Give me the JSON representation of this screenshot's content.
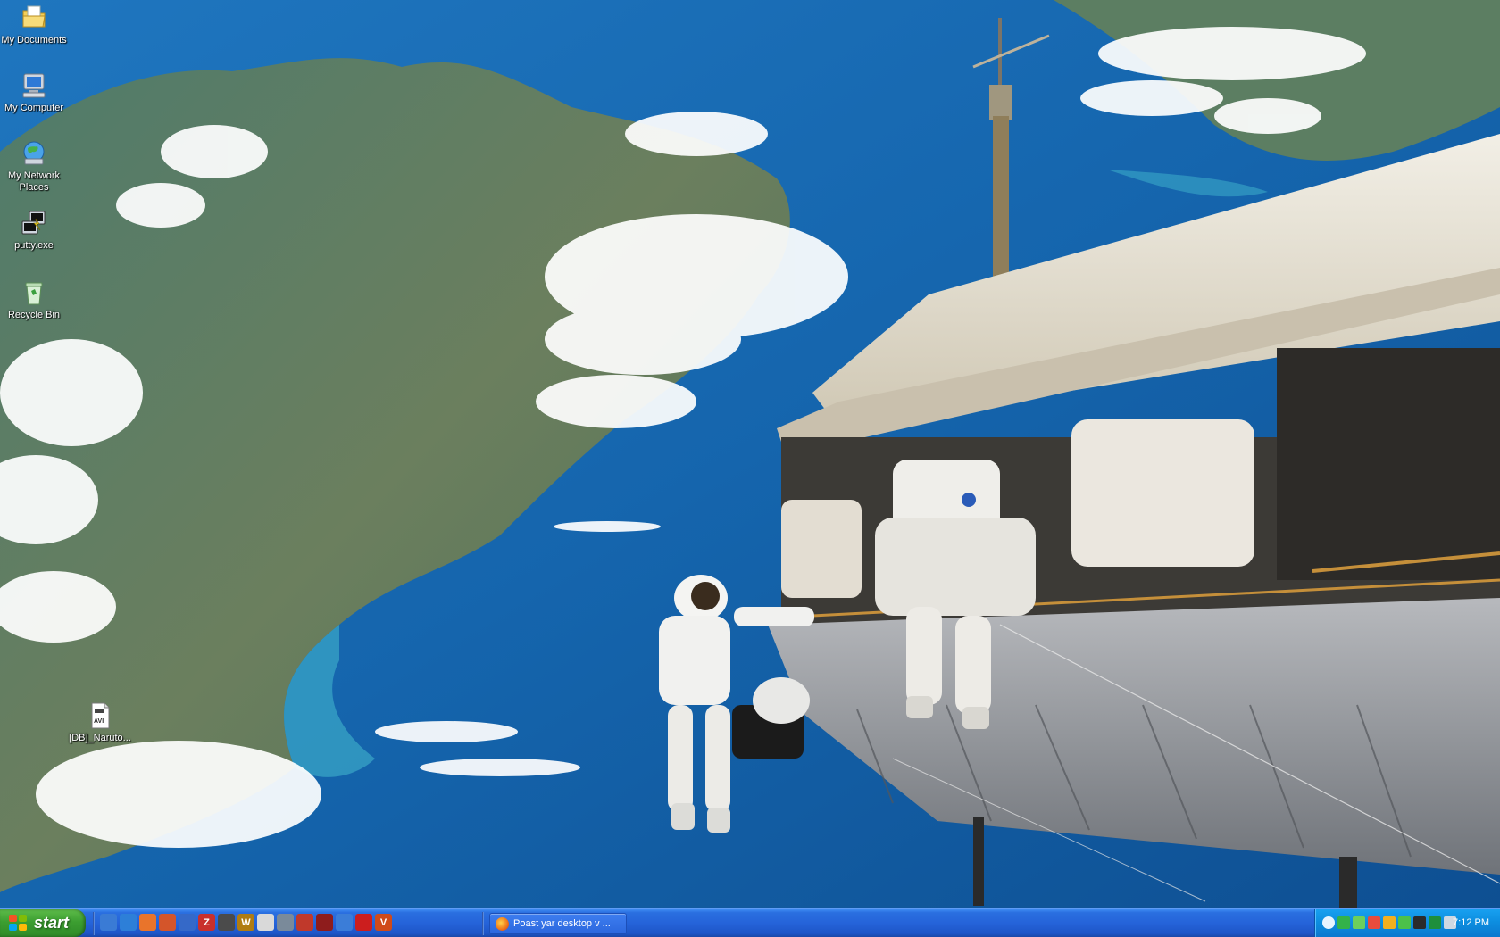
{
  "desktop": {
    "icons": [
      {
        "label": "My Documents",
        "icon": "folder-documents-icon"
      },
      {
        "label": "My Computer",
        "icon": "computer-icon"
      },
      {
        "label": "My Network Places",
        "icon": "network-places-icon"
      },
      {
        "label": "putty.exe",
        "icon": "putty-icon"
      },
      {
        "label": "Recycle Bin",
        "icon": "recycle-bin-icon"
      },
      {
        "label": "[DB]_Naruto...",
        "icon": "avi-video-file-icon",
        "badge": "AVI"
      }
    ]
  },
  "taskbar": {
    "start_label": "start",
    "quick_launch": [
      {
        "icon": "show-desktop-icon",
        "color": "#3a7bd5"
      },
      {
        "icon": "internet-explorer-icon",
        "color": "#2d7fd8"
      },
      {
        "icon": "firefox-icon",
        "color": "#e9742b"
      },
      {
        "icon": "firefox-alt-icon",
        "color": "#d4552a"
      },
      {
        "icon": "media-player-icon",
        "color": "#3569c8"
      },
      {
        "icon": "z-app-icon",
        "color": "#c9302c",
        "glyph": "Z"
      },
      {
        "icon": "calculator-icon",
        "color": "#4b4b4b"
      },
      {
        "icon": "winamp-icon",
        "color": "#b07c12",
        "glyph": "W"
      },
      {
        "icon": "notepad-icon",
        "color": "#d9d9d9"
      },
      {
        "icon": "camera-icon",
        "color": "#7a8a9a"
      },
      {
        "icon": "arrow-app-icon",
        "color": "#c0392b"
      },
      {
        "icon": "game-app-icon",
        "color": "#8e1c1c"
      },
      {
        "icon": "network-tool-icon",
        "color": "#3b7dd8"
      },
      {
        "icon": "opera-icon",
        "color": "#cc1e1e"
      },
      {
        "icon": "vlc-app-icon",
        "color": "#d04a1a",
        "glyph": "V"
      }
    ],
    "tasks": [
      {
        "label": "Poast yar desktop v ...",
        "icon": "firefox-icon"
      }
    ]
  },
  "tray": {
    "icons": [
      {
        "icon": "tray-collapse-icon",
        "color": "#e8f4ff"
      },
      {
        "icon": "messenger-icon",
        "color": "#33b24a"
      },
      {
        "icon": "network-activity-icon",
        "color": "#6ccf5c"
      },
      {
        "icon": "security-icon",
        "color": "#e84c3d"
      },
      {
        "icon": "mail-icon",
        "color": "#f2b01e"
      },
      {
        "icon": "user-status-icon",
        "color": "#4cc14a"
      },
      {
        "icon": "display-icon",
        "color": "#2b2b2b"
      },
      {
        "icon": "color-app-icon",
        "color": "#1e8f3c"
      },
      {
        "icon": "volume-icon",
        "color": "#cfd8e2"
      }
    ],
    "clock": "7:12 PM"
  }
}
